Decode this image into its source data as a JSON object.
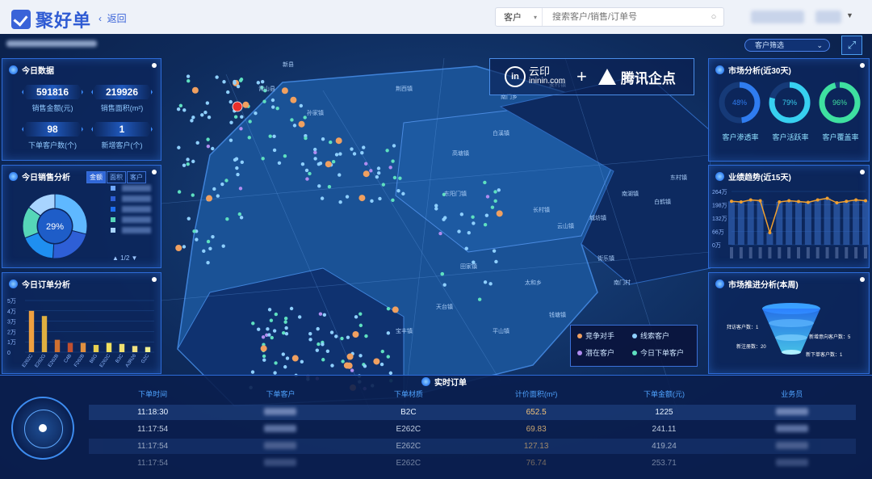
{
  "app": {
    "name": "聚好单",
    "back_label": "返回"
  },
  "search": {
    "scope": "客户",
    "placeholder": "搜索客户/销售/订单号"
  },
  "filter": {
    "customer_filter": "客户筛选"
  },
  "brand": {
    "yunyin": "云印",
    "yunyin_domain": "ininin.com",
    "tencent": "腾讯企点"
  },
  "today_data": {
    "title": "今日数据",
    "stats": [
      {
        "value": "591816",
        "label": "销售金额(元)"
      },
      {
        "value": "219926",
        "label": "销售面积(m²)"
      },
      {
        "value": "98",
        "label": "下单客户数(个)"
      },
      {
        "value": "1",
        "label": "新增客户(个)"
      }
    ]
  },
  "today_sales": {
    "title": "今日销售分析",
    "tabs": [
      "金额",
      "面积",
      "客户"
    ],
    "center_percent": "29%",
    "slices": [
      {
        "color": "#5fb8ff",
        "percent": 29
      },
      {
        "color": "#2e5fd6",
        "percent": 22
      },
      {
        "color": "#1f8ff0",
        "percent": 18
      },
      {
        "color": "#56d6b8",
        "percent": 16
      },
      {
        "color": "#a8d4ff",
        "percent": 15
      }
    ],
    "legend_colors": [
      "#6fa8ff",
      "#2e5fd6",
      "#1f6ff0",
      "#56d6b8",
      "#a8d4ff"
    ],
    "pager": "1/2"
  },
  "today_orders": {
    "title": "今日订单分析",
    "chart_data": {
      "type": "bar",
      "categories": [
        "E262C",
        "E262G",
        "E262B",
        "C4B",
        "F262B",
        "B6G",
        "E262C",
        "B3C",
        "A3R26",
        "G2C"
      ],
      "values": [
        40,
        35,
        12,
        9,
        9,
        7,
        9,
        8,
        6,
        5
      ],
      "yticks": [
        "5万",
        "4万",
        "3万",
        "2万",
        "1万",
        "0"
      ],
      "ylim": [
        0,
        50
      ]
    }
  },
  "market": {
    "title": "市场分析(近30天)",
    "rings": [
      {
        "percent": 48,
        "value": "48%",
        "label": "客户渗透率",
        "color": "#2f7cf0"
      },
      {
        "percent": 79,
        "value": "79%",
        "label": "客户活跃率",
        "color": "#37d0f0"
      },
      {
        "percent": 96,
        "value": "96%",
        "label": "客户覆盖率",
        "color": "#3ee0a0"
      }
    ]
  },
  "trend": {
    "title": "业绩趋势(近15天)",
    "chart_data": {
      "type": "line",
      "yticks": [
        "264万",
        "198万",
        "132万",
        "66万",
        "0万"
      ],
      "ylim": [
        0,
        264
      ],
      "values": [
        215,
        212,
        222,
        218,
        60,
        212,
        218,
        214,
        210,
        222,
        230,
        208,
        215,
        222,
        218
      ]
    }
  },
  "funnel": {
    "title": "市场推进分析(本周)",
    "labels": [
      {
        "text": "拜访客户数：",
        "value": "1"
      },
      {
        "text": "新增意向客户数：",
        "value": "5"
      },
      {
        "text": "新注册数：",
        "value": "20"
      },
      {
        "text": "新下单客户数：",
        "value": "1"
      }
    ]
  },
  "map_legend": {
    "items": [
      {
        "label": "竞争对手",
        "color": "#f0a060"
      },
      {
        "label": "线索客户",
        "color": "#8fd0ff"
      },
      {
        "label": "潜在客户",
        "color": "#b08cf0"
      },
      {
        "label": "今日下单客户",
        "color": "#5ee0c0"
      }
    ]
  },
  "map_places": [
    "新县",
    "青山县",
    "孙家镇",
    "荆西镇",
    "南门乡",
    "麦村镇",
    "高塘镇",
    "白溪镇",
    "东阳门镇",
    "长村镇",
    "云山镇",
    "南湖镇",
    "白鹤镇",
    "城坊镇",
    "田家镇",
    "天台镇",
    "宝丰镇",
    "太和乡",
    "平山镇",
    "钱塘镇",
    "南门村",
    "东村镇",
    "街乐镇"
  ],
  "orders": {
    "title": "实时订单",
    "columns": [
      "下单时间",
      "下单客户",
      "下单材质",
      "计价面积(m²)",
      "下单金额(元)",
      "业务员"
    ],
    "rows": [
      {
        "time": "11:18:30",
        "material": "B2C",
        "area": "652.5",
        "amount": "1225"
      },
      {
        "time": "11:17:54",
        "material": "E262C",
        "area": "69.83",
        "amount": "241.11"
      },
      {
        "time": "11:17:54",
        "material": "E262C",
        "area": "127.13",
        "amount": "419.24"
      },
      {
        "time": "11:17:54",
        "material": "E262C",
        "area": "76.74",
        "amount": "253.71"
      }
    ]
  }
}
